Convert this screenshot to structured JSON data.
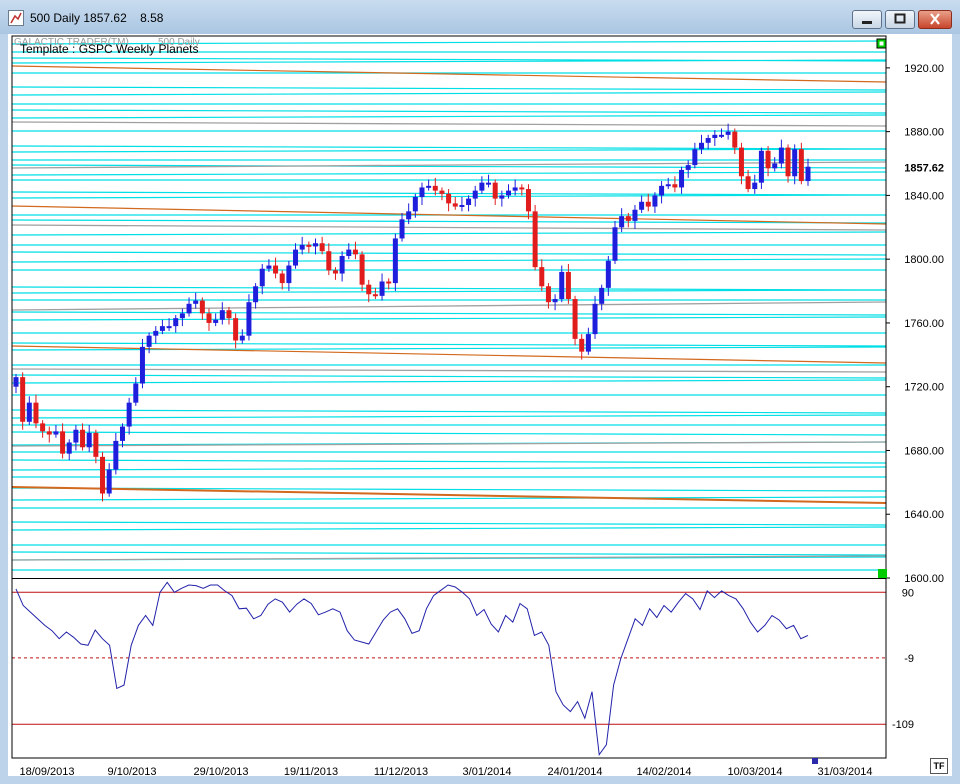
{
  "window": {
    "title": "500 Daily 1857.62    8.58",
    "buttons": {
      "minimize": "minimize-icon",
      "restore": "restore-icon",
      "close": "close-icon"
    }
  },
  "header": {
    "brand": "GALACTIC TRADER(TM)",
    "symbol": "500 Daily",
    "template": "Template : GSPC Weekly Planets"
  },
  "corner_label": "TF",
  "colors": {
    "up": "#1e1edc",
    "down": "#e01c1c",
    "cyan": "#00dfe6",
    "orange": "#d2691e",
    "grey": "#a0a0a0",
    "osc": "#2222aa",
    "level": "#c01010",
    "marker": "#00cc00"
  },
  "chart_data": [
    {
      "type": "candlestick",
      "title": "",
      "ylim": [
        1600,
        1940
      ],
      "y_ticks": [
        "1920.00",
        "1880.00",
        "1840.00",
        "1800.00",
        "1760.00",
        "1720.00",
        "1680.00",
        "1640.00",
        "1600.00"
      ],
      "last_value": "1857.62",
      "x_labels": [
        "18/09/2013",
        "9/10/2013",
        "29/10/2013",
        "19/11/2013",
        "11/12/2013",
        "3/01/2014",
        "24/01/2014",
        "14/02/2014",
        "10/03/2014",
        "31/03/2014"
      ],
      "close": [
        1726,
        1698,
        1710,
        1697,
        1692,
        1690,
        1692,
        1678,
        1685,
        1693,
        1682,
        1691,
        1676,
        1653,
        1668,
        1686,
        1695,
        1710,
        1722,
        1745,
        1752,
        1755,
        1758,
        1758,
        1763,
        1766,
        1772,
        1774,
        1766,
        1760,
        1762,
        1768,
        1763,
        1749,
        1752,
        1773,
        1783,
        1794,
        1796,
        1791,
        1785,
        1796,
        1806,
        1809,
        1808,
        1810,
        1805,
        1793,
        1791,
        1802,
        1806,
        1803,
        1784,
        1778,
        1777,
        1786,
        1785,
        1813,
        1825,
        1830,
        1839,
        1845,
        1846,
        1843,
        1841,
        1835,
        1833,
        1834,
        1838,
        1843,
        1848,
        1848,
        1838,
        1840,
        1843,
        1845,
        1844,
        1830,
        1795,
        1783,
        1773,
        1775,
        1792,
        1775,
        1750,
        1742,
        1753,
        1772,
        1782,
        1799,
        1820,
        1827,
        1824,
        1831,
        1836,
        1833,
        1840,
        1846,
        1847,
        1845,
        1856,
        1859,
        1869,
        1873,
        1876,
        1878,
        1878,
        1880,
        1870,
        1852,
        1844,
        1848,
        1868,
        1857,
        1860,
        1870,
        1852,
        1869,
        1849,
        1858
      ],
      "oscillator": {
        "ylim": [
          -160,
          110
        ],
        "levels": [
          "90",
          "-9",
          "-109"
        ],
        "level_values": [
          90,
          -9,
          -109
        ],
        "values": [
          95,
          70,
          60,
          50,
          40,
          32,
          20,
          30,
          22,
          12,
          10,
          33,
          20,
          10,
          -55,
          -50,
          10,
          40,
          55,
          40,
          90,
          105,
          90,
          96,
          101,
          100,
          96,
          101,
          101,
          92,
          85,
          65,
          66,
          50,
          55,
          72,
          80,
          75,
          60,
          72,
          80,
          73,
          56,
          60,
          65,
          60,
          32,
          18,
          15,
          12,
          30,
          48,
          60,
          65,
          50,
          28,
          32,
          65,
          85,
          93,
          101,
          98,
          90,
          80,
          55,
          64,
          42,
          30,
          55,
          45,
          73,
          65,
          25,
          30,
          10,
          -60,
          -80,
          -90,
          -75,
          -100,
          -60,
          -155,
          -140,
          -50,
          -10,
          20,
          50,
          40,
          65,
          52,
          70,
          60,
          75,
          88,
          80,
          64,
          92,
          82,
          92,
          85,
          80,
          65,
          45,
          30,
          40,
          55,
          48,
          35,
          40,
          20,
          25
        ]
      }
    }
  ]
}
